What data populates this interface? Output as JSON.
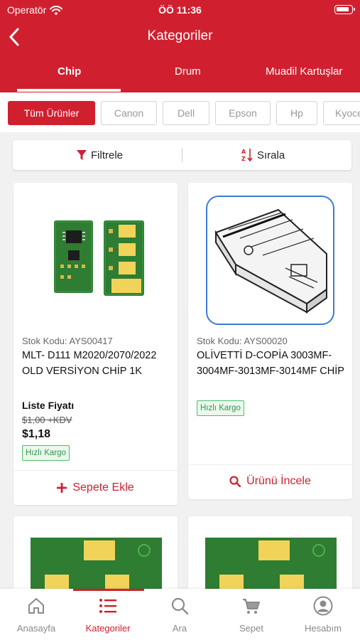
{
  "status_bar": {
    "carrier": "Operatör",
    "time": "ÖÖ 11:36"
  },
  "header": {
    "title": "Kategoriler"
  },
  "tabs": [
    {
      "label": "Chip",
      "active": true
    },
    {
      "label": "Drum",
      "active": false
    },
    {
      "label": "Muadil Kartuşlar",
      "active": false
    }
  ],
  "brand_chips": [
    {
      "label": "Tüm Ürünler",
      "active": true
    },
    {
      "label": "Canon",
      "active": false
    },
    {
      "label": "Dell",
      "active": false
    },
    {
      "label": "Epson",
      "active": false
    },
    {
      "label": "Hp",
      "active": false
    },
    {
      "label": "Kyocera",
      "active": false
    }
  ],
  "toolbar": {
    "filter_label": "Filtrele",
    "sort_label": "Sırala"
  },
  "products": [
    {
      "code": "Stok Kodu: AYS00417",
      "name": "MLT- D111 M2020/2070/2022 OLD VERSİYON CHİP 1K",
      "list_label": "Liste Fiyatı",
      "old_price": "$1,00 +KDV",
      "price": "$1,18",
      "badge": "Hızlı Kargo",
      "action": "Sepete Ekle",
      "action_icon": "plus-icon"
    },
    {
      "code": "Stok Kodu: AYS00020",
      "name": "OLİVETTİ D-COPİA 3003MF-3004MF-3013MF-3014MF CHİP",
      "badge": "Hızlı Kargo",
      "action": "Ürünü İncele",
      "action_icon": "search-icon"
    }
  ],
  "bottom_nav": [
    {
      "label": "Anasayfa",
      "icon": "home-icon",
      "active": false
    },
    {
      "label": "Kategoriler",
      "icon": "list-icon",
      "active": true
    },
    {
      "label": "Ara",
      "icon": "search-icon",
      "active": false
    },
    {
      "label": "Sepet",
      "icon": "cart-icon",
      "active": false
    },
    {
      "label": "Hesabım",
      "icon": "account-icon",
      "active": false
    }
  ],
  "colors": {
    "brand": "#d0202f",
    "badge_green": "#4cbf6b",
    "chip_green": "#2e7d32",
    "pad_gold": "#f2d35a"
  }
}
